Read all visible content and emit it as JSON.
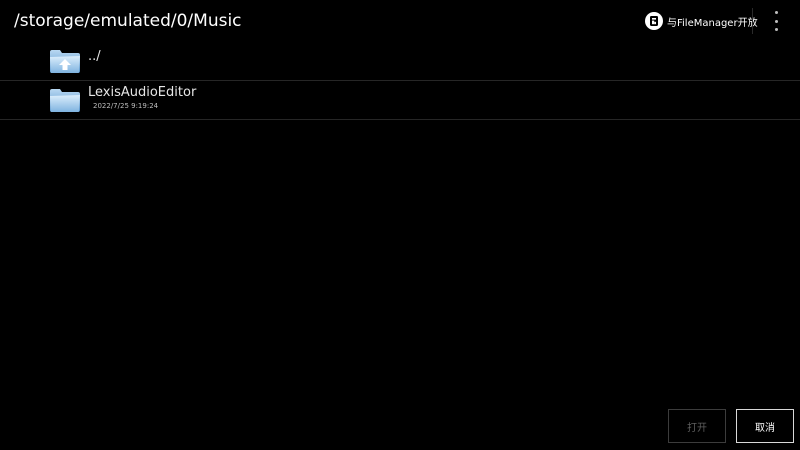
{
  "header": {
    "path_title": "/storage/emulated/0/Music",
    "open_with_label": "与FileManager开放",
    "open_with_icon": "filemanager-icon",
    "overflow_icon": "more-vertical-icon"
  },
  "file_list": {
    "items": [
      {
        "name": "../",
        "icon": "folder-up-icon",
        "date": ""
      },
      {
        "name": "LexisAudioEditor",
        "icon": "folder-icon",
        "date": "2022/7/25 9:19:24"
      }
    ]
  },
  "footer": {
    "open_label": "打开",
    "open_enabled": false,
    "cancel_label": "取消"
  },
  "colors": {
    "background": "#000000",
    "text": "#ffffff",
    "folder_blue": "#6fa8dc",
    "divider": "#262626",
    "disabled_text": "#5e5e5e"
  }
}
